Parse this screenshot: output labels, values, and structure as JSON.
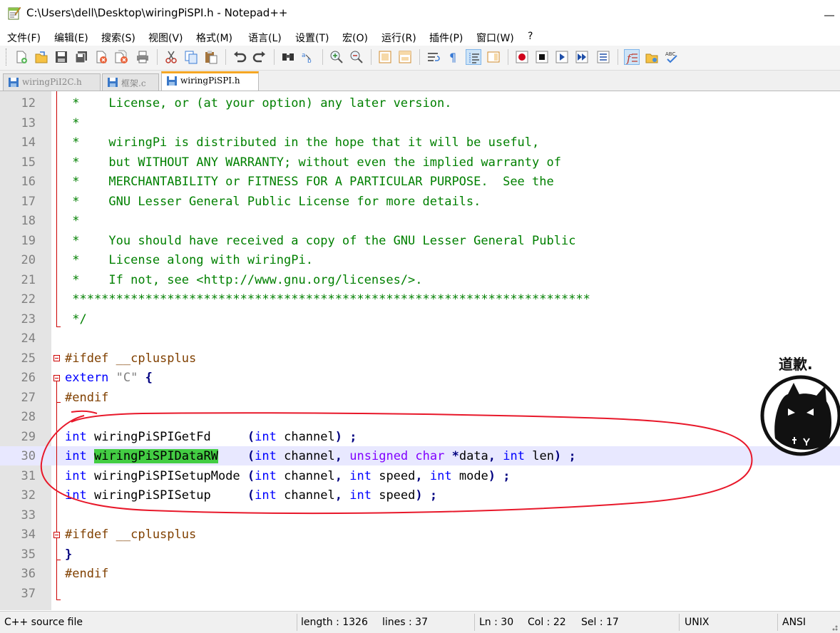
{
  "window": {
    "title": "C:\\Users\\dell\\Desktop\\wiringPiSPI.h - Notepad++"
  },
  "menu": [
    "文件(F)",
    "编辑(E)",
    "搜索(S)",
    "视图(V)",
    "格式(M)",
    "语言(L)",
    "设置(T)",
    "宏(O)",
    "运行(R)",
    "插件(P)",
    "窗口(W)",
    "?"
  ],
  "toolbar": {
    "icons": [
      "new-file-icon",
      "open-file-icon",
      "save-icon",
      "save-all-icon",
      "close-icon",
      "close-all-icon",
      "print-icon",
      "cut-icon",
      "copy-icon",
      "paste-icon",
      "undo-icon",
      "redo-icon",
      "find-icon",
      "replace-icon",
      "zoom-in-icon",
      "zoom-out-icon",
      "sync-vertical-icon",
      "sync-horizontal-icon",
      "word-wrap-icon",
      "show-all-chars-icon",
      "indent-guide-icon",
      "doc-map-icon",
      "record-macro-icon",
      "stop-record-icon",
      "play-macro-icon",
      "run-macro-multiple-icon",
      "save-macro-icon",
      "function-list-icon",
      "folder-workspace-icon",
      "spell-check-icon"
    ]
  },
  "tabs": [
    {
      "label": "wiringPiI2C.h",
      "active": false
    },
    {
      "label": "框架.c",
      "active": false
    },
    {
      "label": "wiringPiSPI.h",
      "active": true
    }
  ],
  "editor": {
    "lines": [
      {
        "n": "12",
        "tokens": [
          {
            "t": " *    License, or (at your option) any later version.",
            "c": "com"
          }
        ]
      },
      {
        "n": "13",
        "tokens": [
          {
            "t": " *",
            "c": "com"
          }
        ]
      },
      {
        "n": "14",
        "tokens": [
          {
            "t": " *    wiringPi is distributed in the hope that it will be useful,",
            "c": "com"
          }
        ]
      },
      {
        "n": "15",
        "tokens": [
          {
            "t": " *    but WITHOUT ANY WARRANTY; without even the implied warranty of",
            "c": "com"
          }
        ]
      },
      {
        "n": "16",
        "tokens": [
          {
            "t": " *    MERCHANTABILITY or FITNESS FOR A PARTICULAR PURPOSE.  See the",
            "c": "com"
          }
        ]
      },
      {
        "n": "17",
        "tokens": [
          {
            "t": " *    GNU Lesser General Public License for more details.",
            "c": "com"
          }
        ]
      },
      {
        "n": "18",
        "tokens": [
          {
            "t": " *",
            "c": "com"
          }
        ]
      },
      {
        "n": "19",
        "tokens": [
          {
            "t": " *    You should have received a copy of the GNU Lesser General Public",
            "c": "com"
          }
        ]
      },
      {
        "n": "20",
        "tokens": [
          {
            "t": " *    License along with wiringPi.",
            "c": "com"
          }
        ]
      },
      {
        "n": "21",
        "tokens": [
          {
            "t": " *    If not, see <http://www.gnu.org/licenses/>.",
            "c": "com"
          }
        ]
      },
      {
        "n": "22",
        "tokens": [
          {
            "t": " ***********************************************************************",
            "c": "com"
          }
        ]
      },
      {
        "n": "23",
        "tokens": [
          {
            "t": " */",
            "c": "com"
          }
        ]
      },
      {
        "n": "24",
        "tokens": []
      },
      {
        "n": "25",
        "tokens": [
          {
            "t": "#ifdef __cplusplus",
            "c": "pre"
          }
        ]
      },
      {
        "n": "26",
        "tokens": [
          {
            "t": "extern",
            "c": "kw"
          },
          {
            "t": " ",
            "c": ""
          },
          {
            "t": "\"C\"",
            "c": "str"
          },
          {
            "t": " ",
            "c": ""
          },
          {
            "t": "{",
            "c": "op"
          }
        ]
      },
      {
        "n": "27",
        "tokens": [
          {
            "t": "#endif",
            "c": "pre"
          }
        ]
      },
      {
        "n": "28",
        "tokens": []
      },
      {
        "n": "29",
        "tokens": [
          {
            "t": "int",
            "c": "kw"
          },
          {
            "t": " wiringPiSPIGetFd     ",
            "c": ""
          },
          {
            "t": "(",
            "c": "op"
          },
          {
            "t": "int",
            "c": "kw"
          },
          {
            "t": " channel",
            "c": ""
          },
          {
            "t": ")",
            "c": "op"
          },
          {
            "t": " ",
            "c": ""
          },
          {
            "t": ";",
            "c": "op"
          }
        ]
      },
      {
        "n": "30",
        "current": true,
        "tokens": [
          {
            "t": "int",
            "c": "kw"
          },
          {
            "t": " ",
            "c": ""
          },
          {
            "t": "wiringPiSPIDataRW",
            "c": "sel"
          },
          {
            "t": "    ",
            "c": ""
          },
          {
            "t": "(",
            "c": "op"
          },
          {
            "t": "int",
            "c": "kw"
          },
          {
            "t": " channel",
            "c": ""
          },
          {
            "t": ",",
            "c": "op"
          },
          {
            "t": " ",
            "c": ""
          },
          {
            "t": "unsigned char",
            "c": "type"
          },
          {
            "t": " ",
            "c": ""
          },
          {
            "t": "*",
            "c": "op"
          },
          {
            "t": "data",
            "c": ""
          },
          {
            "t": ",",
            "c": "op"
          },
          {
            "t": " ",
            "c": ""
          },
          {
            "t": "int",
            "c": "kw"
          },
          {
            "t": " len",
            "c": ""
          },
          {
            "t": ")",
            "c": "op"
          },
          {
            "t": " ",
            "c": ""
          },
          {
            "t": ";",
            "c": "op"
          }
        ]
      },
      {
        "n": "31",
        "tokens": [
          {
            "t": "int",
            "c": "kw"
          },
          {
            "t": " wiringPiSPISetupMode ",
            "c": ""
          },
          {
            "t": "(",
            "c": "op"
          },
          {
            "t": "int",
            "c": "kw"
          },
          {
            "t": " channel",
            "c": ""
          },
          {
            "t": ",",
            "c": "op"
          },
          {
            "t": " ",
            "c": ""
          },
          {
            "t": "int",
            "c": "kw"
          },
          {
            "t": " speed",
            "c": ""
          },
          {
            "t": ",",
            "c": "op"
          },
          {
            "t": " ",
            "c": ""
          },
          {
            "t": "int",
            "c": "kw"
          },
          {
            "t": " mode",
            "c": ""
          },
          {
            "t": ")",
            "c": "op"
          },
          {
            "t": " ",
            "c": ""
          },
          {
            "t": ";",
            "c": "op"
          }
        ]
      },
      {
        "n": "32",
        "tokens": [
          {
            "t": "int",
            "c": "kw"
          },
          {
            "t": " wiringPiSPISetup     ",
            "c": ""
          },
          {
            "t": "(",
            "c": "op"
          },
          {
            "t": "int",
            "c": "kw"
          },
          {
            "t": " channel",
            "c": ""
          },
          {
            "t": ",",
            "c": "op"
          },
          {
            "t": " ",
            "c": ""
          },
          {
            "t": "int",
            "c": "kw"
          },
          {
            "t": " speed",
            "c": ""
          },
          {
            "t": ")",
            "c": "op"
          },
          {
            "t": " ",
            "c": ""
          },
          {
            "t": ";",
            "c": "op"
          }
        ]
      },
      {
        "n": "33",
        "tokens": []
      },
      {
        "n": "34",
        "tokens": [
          {
            "t": "#ifdef __cplusplus",
            "c": "pre"
          }
        ]
      },
      {
        "n": "35",
        "tokens": [
          {
            "t": "}",
            "c": "op"
          }
        ]
      },
      {
        "n": "36",
        "tokens": [
          {
            "t": "#endif",
            "c": "pre"
          }
        ]
      },
      {
        "n": "37",
        "tokens": []
      }
    ]
  },
  "sticker": {
    "caption": "道歉."
  },
  "status": {
    "file_type": "C++ source file",
    "length": "length : 1326",
    "lines": "lines : 37",
    "ln": "Ln : 30",
    "col": "Col : 22",
    "sel": "Sel : 17",
    "eol": "UNIX",
    "encoding": "ANSI"
  },
  "colors": {
    "comment": "#008000",
    "preprocessor": "#804000",
    "keyword": "#0000ff",
    "type": "#8000ff",
    "selection": "#43cd43",
    "current_line": "#e8e8ff",
    "annotation": "#e8182a"
  }
}
